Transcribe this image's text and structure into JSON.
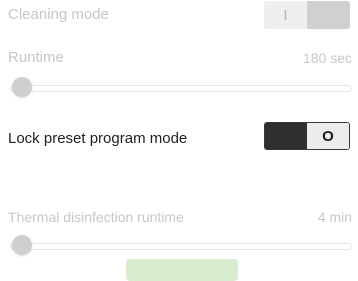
{
  "cleaning_mode": {
    "label": "Cleaning mode",
    "toggle_left": "I",
    "toggle_right": "",
    "state": "disabled"
  },
  "runtime": {
    "label": "Runtime",
    "value": "180 sec"
  },
  "lock_preset": {
    "label": "Lock preset program mode",
    "toggle_left": "",
    "toggle_right": "O",
    "state": "off"
  },
  "thermal_disinfection": {
    "label": "Thermal disinfection runtime",
    "value": "4 min"
  },
  "colors": {
    "disabled_text": "#c7c7c7",
    "active_text": "#1f1f1f",
    "accent_green": "#d9ecd0"
  }
}
